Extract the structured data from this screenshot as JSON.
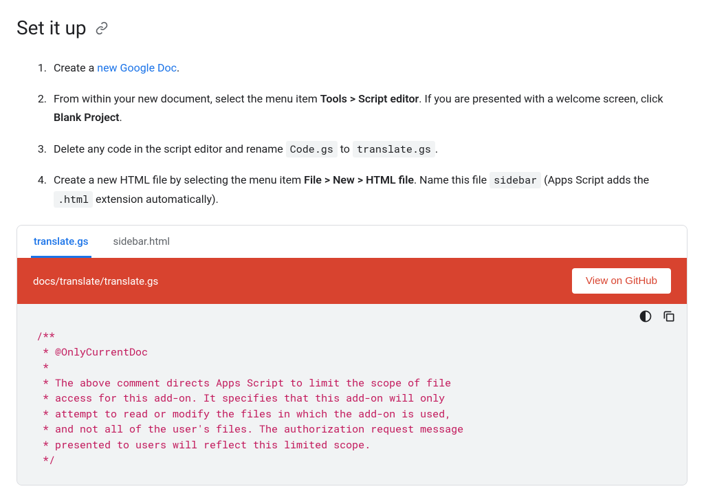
{
  "heading": "Set it up",
  "steps": {
    "s1_prefix": "Create a ",
    "s1_link": "new Google Doc",
    "s1_suffix": ".",
    "s2_a": "From within your new document, select the menu item ",
    "s2_b": "Tools > Script editor",
    "s2_c": ". If you are presented with a welcome screen, click ",
    "s2_d": "Blank Project",
    "s2_e": ".",
    "s3_a": "Delete any code in the script editor and rename ",
    "s3_code1": "Code.gs",
    "s3_b": " to ",
    "s3_code2": "translate.gs",
    "s3_c": ".",
    "s4_a": "Create a new HTML file by selecting the menu item ",
    "s4_b": "File > New > HTML file",
    "s4_c": ". Name this file ",
    "s4_code1": "sidebar",
    "s4_d": " (Apps Script adds the ",
    "s4_code2": ".html",
    "s4_e": " extension automatically)."
  },
  "tabs": {
    "t1": "translate.gs",
    "t2": "sidebar.html"
  },
  "codeHeader": {
    "path": "docs/translate/translate.gs",
    "button": "View on GitHub"
  },
  "code": "/**\n * @OnlyCurrentDoc\n *\n * The above comment directs Apps Script to limit the scope of file\n * access for this add-on. It specifies that this add-on will only\n * attempt to read or modify the files in which the add-on is used,\n * and not all of the user's files. The authorization request message\n * presented to users will reflect this limited scope.\n */"
}
